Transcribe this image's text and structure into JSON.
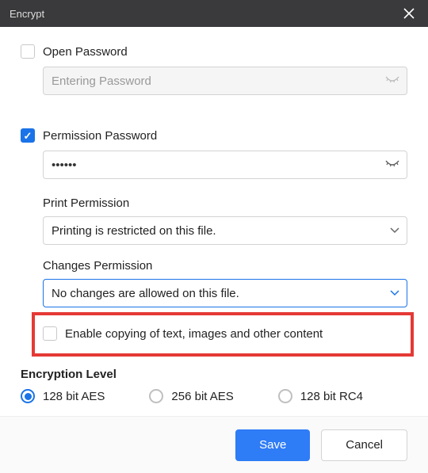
{
  "titlebar": {
    "title": "Encrypt"
  },
  "open_password": {
    "label": "Open Password",
    "checked": false,
    "placeholder": "Entering Password",
    "value": ""
  },
  "permission_password": {
    "label": "Permission Password",
    "checked": true,
    "value": "••••••"
  },
  "print_permission": {
    "label": "Print Permission",
    "value": "Printing is restricted on this file."
  },
  "changes_permission": {
    "label": "Changes Permission",
    "value": "No changes are allowed on this file."
  },
  "enable_copy": {
    "label": "Enable copying of text, images and other content",
    "checked": false
  },
  "encryption": {
    "heading": "Encryption Level",
    "options": [
      {
        "label": "128 bit AES",
        "selected": true
      },
      {
        "label": "256 bit AES",
        "selected": false
      },
      {
        "label": "128 bit RC4",
        "selected": false
      }
    ]
  },
  "buttons": {
    "save": "Save",
    "cancel": "Cancel"
  }
}
